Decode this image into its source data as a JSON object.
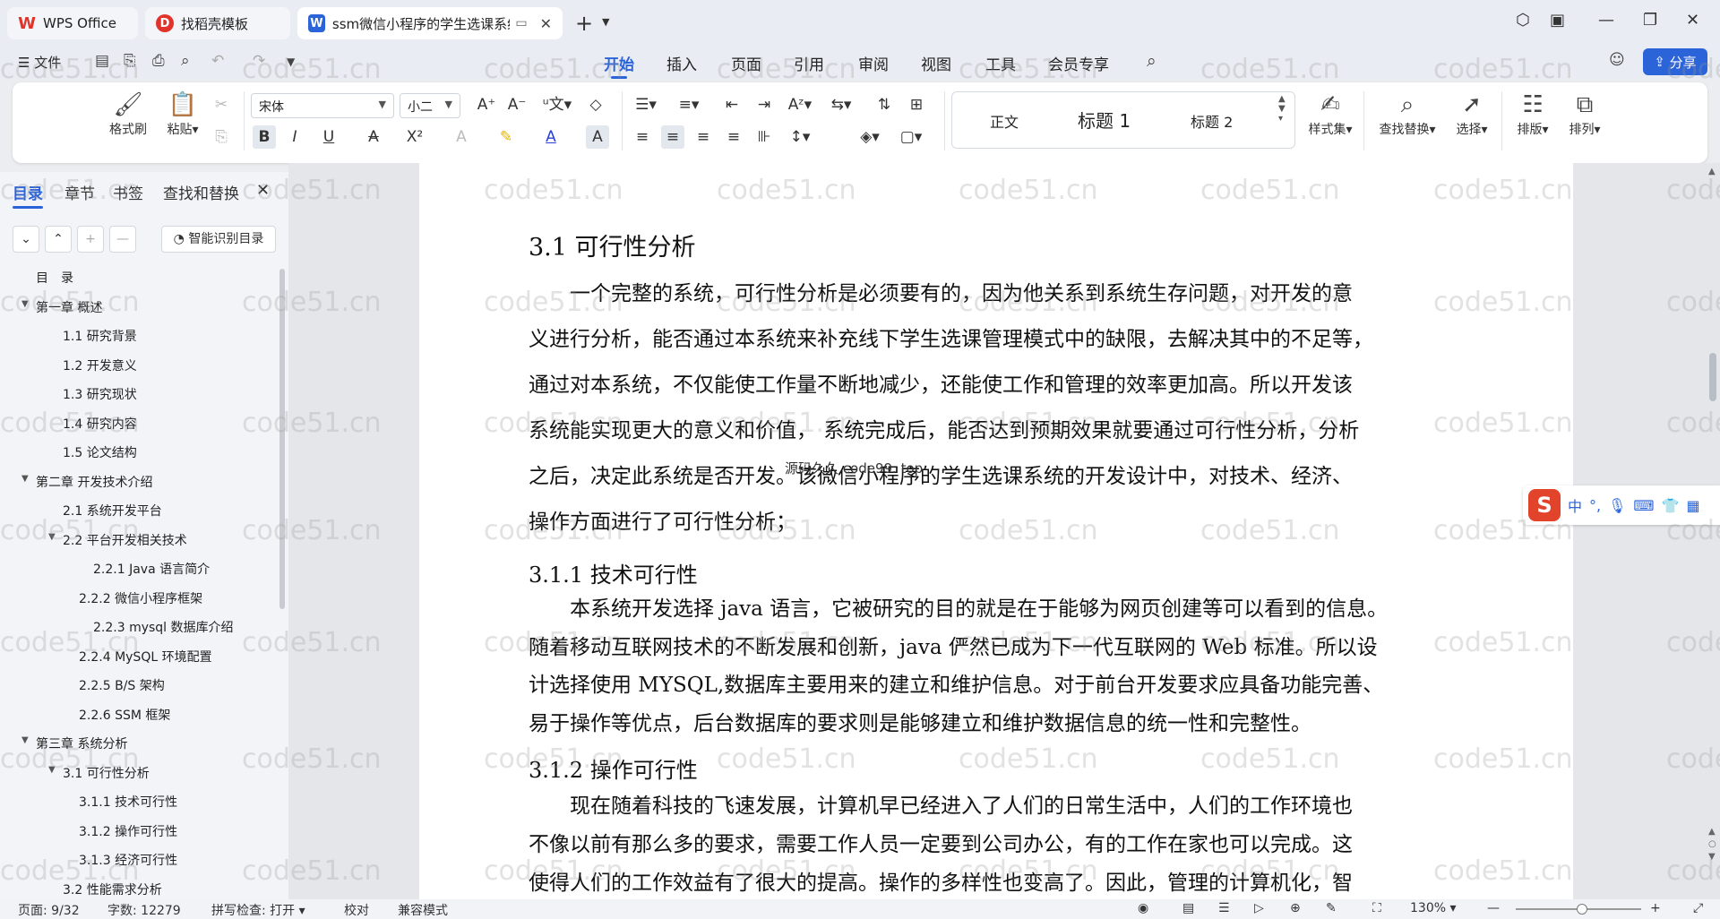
{
  "tabs": [
    {
      "label": "WPS Office",
      "icon": "wps-logo-icon"
    },
    {
      "label": "找稻壳模板",
      "icon": "docer-icon"
    },
    {
      "label": "ssm微信小程序的学生选课系统",
      "icon": "word-doc-icon"
    }
  ],
  "menu": {
    "file": "文件",
    "tabs": [
      "开始",
      "插入",
      "页面",
      "引用",
      "审阅",
      "视图",
      "工具",
      "会员专享"
    ],
    "active": "开始",
    "share": "分享"
  },
  "ribbon": {
    "format_painter": "格式刷",
    "paste": "粘贴",
    "font_name": "宋体",
    "font_size": "小二",
    "styles": [
      "正文",
      "标题 1",
      "标题 2"
    ],
    "style_set": "样式集",
    "find_replace": "查找替换",
    "select": "选择",
    "layout": "排版",
    "arrange": "排列"
  },
  "nav": {
    "tabs": [
      "目录",
      "章节",
      "书签",
      "查找和替换"
    ],
    "smart_toc": "智能识别目录",
    "toc": [
      {
        "text": "目　录",
        "level": 0,
        "toggle": ""
      },
      {
        "text": "第一章  概述",
        "level": 0,
        "toggle": "▼"
      },
      {
        "text": "1.1  研究背景",
        "level": 1,
        "toggle": ""
      },
      {
        "text": "1.2  开发意义",
        "level": 1,
        "toggle": ""
      },
      {
        "text": "1.3  研究现状",
        "level": 1,
        "toggle": ""
      },
      {
        "text": "1.4  研究内容",
        "level": 1,
        "toggle": ""
      },
      {
        "text": "1.5  论文结构",
        "level": 1,
        "toggle": ""
      },
      {
        "text": "第二章  开发技术介绍",
        "level": 0,
        "toggle": "▼"
      },
      {
        "text": "2.1  系统开发平台",
        "level": 1,
        "toggle": ""
      },
      {
        "text": "2.2  平台开发相关技术",
        "level": 1,
        "toggle": "▼"
      },
      {
        "text": "2.2.1    Java 语言简介",
        "level": 3,
        "toggle": ""
      },
      {
        "text": "2.2.2    微信小程序框架",
        "level": 2,
        "toggle": ""
      },
      {
        "text": "2.2.3    mysql 数据库介绍",
        "level": 3,
        "toggle": ""
      },
      {
        "text": "2.2.4    MySQL 环境配置",
        "level": 2,
        "toggle": ""
      },
      {
        "text": "2.2.5    B/S 架构",
        "level": 2,
        "toggle": ""
      },
      {
        "text": "2.2.6    SSM 框架",
        "level": 2,
        "toggle": ""
      },
      {
        "text": "第三章  系统分析",
        "level": 0,
        "toggle": "▼"
      },
      {
        "text": "3.1  可行性分析",
        "level": 1,
        "toggle": "▼"
      },
      {
        "text": "3.1.1  技术可行性",
        "level": 2,
        "toggle": ""
      },
      {
        "text": "3.1.2  操作可行性",
        "level": 2,
        "toggle": ""
      },
      {
        "text": "3.1.3  经济可行性",
        "level": 2,
        "toggle": ""
      },
      {
        "text": "3.2  性能需求分析",
        "level": 1,
        "toggle": ""
      }
    ]
  },
  "doc": {
    "h_31": "3.1  可行性分析",
    "p1": [
      "　　一个完整的系统，可行性分析是必须要有的，因为他关系到系统生存问题，对开发的意",
      "义进行分析，能否通过本系统来补充线下学生选课管理模式中的缺限，去解决其中的不足等，",
      "通过对本系统，不仅能使工作量不断地减少，还能使工作和管理的效率更加高。所以开发该",
      "系统能实现更大的意义和价值，  系统完成后，能否达到预期效果就要通过可行性分析，分析",
      "之后，决定此系统是否开发。该微信小程序的学生选课系统的开发设计中，对技术、经济、",
      "操作方面进行了可行性分析；"
    ],
    "h_311": "3.1.1  技术可行性",
    "p2": [
      "　　本系统开发选择 java 语言，它被研究的目的就是在于能够为网页创建等可以看到的信息。",
      "随着移动互联网技术的不断发展和创新，java 俨然已成为下一代互联网的 Web 标准。所以设",
      "计选择使用 MYSQL,数据库主要用来的建立和维护信息。对于前台开发要求应具备功能完善、",
      "易于操作等优点，后台数据库的要求则是能够建立和维护数据信息的统一性和完整性。"
    ],
    "h_312": "3.1.2  操作可行性",
    "p3": [
      "　　现在随着科技的飞速发展，计算机早已经进入了人们的日常生活中，人们的工作环境也",
      "不像以前有那么多的要求，需要工作人员一定要到公司办公，有的工作在家也可以完成。这",
      "使得人们的工作效益有了很大的提高。操作的多样性也变高了。因此，管理的计算机化，智"
    ],
    "overlay_text": "源码久久  code99. top"
  },
  "ime": {
    "mode": "中",
    "punct": "°,"
  },
  "watermark": "code51.cn",
  "status": {
    "page": "页面: 9/32",
    "words": "字数: 12279",
    "spell": "拼写检查: 打开",
    "proof": "校对",
    "compat": "兼容模式",
    "zoom": "130%"
  },
  "colors": {
    "accent": "#2b63d9",
    "wps_red": "#e2332b"
  }
}
